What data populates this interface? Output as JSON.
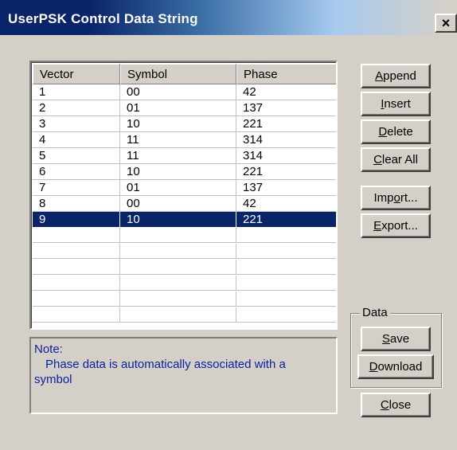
{
  "window": {
    "title": "UserPSK Control Data String",
    "close_glyph": "×"
  },
  "grid": {
    "headers": [
      "Vector",
      "Symbol",
      "Phase"
    ],
    "rows": [
      [
        "1",
        "00",
        "42"
      ],
      [
        "2",
        "01",
        "137"
      ],
      [
        "3",
        "10",
        "221"
      ],
      [
        "4",
        "11",
        "314"
      ],
      [
        "5",
        "11",
        "314"
      ],
      [
        "6",
        "10",
        "221"
      ],
      [
        "7",
        "01",
        "137"
      ],
      [
        "8",
        "00",
        "42"
      ],
      [
        "9",
        "10",
        "221"
      ]
    ],
    "selected_row_index": 8
  },
  "note": {
    "label": "Note:",
    "line1": "Phase data is automatically associated with a",
    "line2": "symbol"
  },
  "buttons": {
    "append": {
      "pre": "",
      "key": "A",
      "post": "ppend"
    },
    "insert": {
      "pre": "",
      "key": "I",
      "post": "nsert"
    },
    "delete": {
      "pre": "",
      "key": "D",
      "post": "elete"
    },
    "clear_all": {
      "pre": "",
      "key": "C",
      "post": "lear All"
    },
    "import": {
      "pre": "Imp",
      "key": "o",
      "post": "rt..."
    },
    "export": {
      "pre": "",
      "key": "E",
      "post": "xport..."
    },
    "save": {
      "pre": "",
      "key": "S",
      "post": "ave"
    },
    "download": {
      "pre": "",
      "key": "D",
      "post": "ownload"
    },
    "close": {
      "pre": "",
      "key": "C",
      "post": "lose"
    }
  },
  "data_group": {
    "label": "Data"
  },
  "colors": {
    "title_bar": "#0a246a",
    "selection": "#0a246a",
    "dialog_face": "#d4d0c8",
    "note_text": "#0a1f9e"
  }
}
